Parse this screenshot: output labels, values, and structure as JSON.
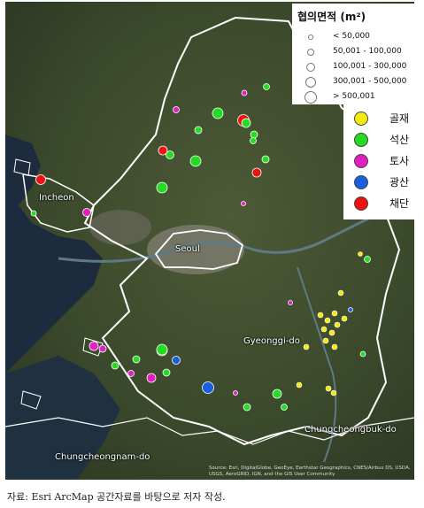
{
  "map": {
    "places": {
      "incheon": "Incheon",
      "seoul": "Seoul",
      "gyeonggi": "Gyeonggi-do",
      "chungbuk": "Chungcheongbuk-do",
      "chungnam": "Chungcheongnam-do"
    },
    "attribution": "Source: Esri, DigitalGlobe, GeoEye, Earthstar Geographics, CNES/Airbus DS, USDA, USGS, AeroGRID, IGN, and the GIS User Community",
    "colors": {
      "골재": "#f5ea10",
      "석산": "#22dd22",
      "토사": "#e020c0",
      "광산": "#1a5fe0",
      "채단": "#ee1111"
    }
  },
  "legend_size": {
    "title": "협의면적 (m²)",
    "classes": [
      "< 50,000",
      "50,001 - 100,000",
      "100,001 - 300,000",
      "300,001 - 500,000",
      "> 500,001"
    ]
  },
  "legend_type": {
    "items": [
      {
        "label": "골재",
        "color": "#f5ea10"
      },
      {
        "label": "석산",
        "color": "#22dd22"
      },
      {
        "label": "토사",
        "color": "#e020c0"
      },
      {
        "label": "광산",
        "color": "#1a5fe0"
      },
      {
        "label": "채단",
        "color": "#ee1111"
      }
    ]
  },
  "caption": "자료: Esri ArcMap 공간자료를 바탕으로 저자 작성."
}
